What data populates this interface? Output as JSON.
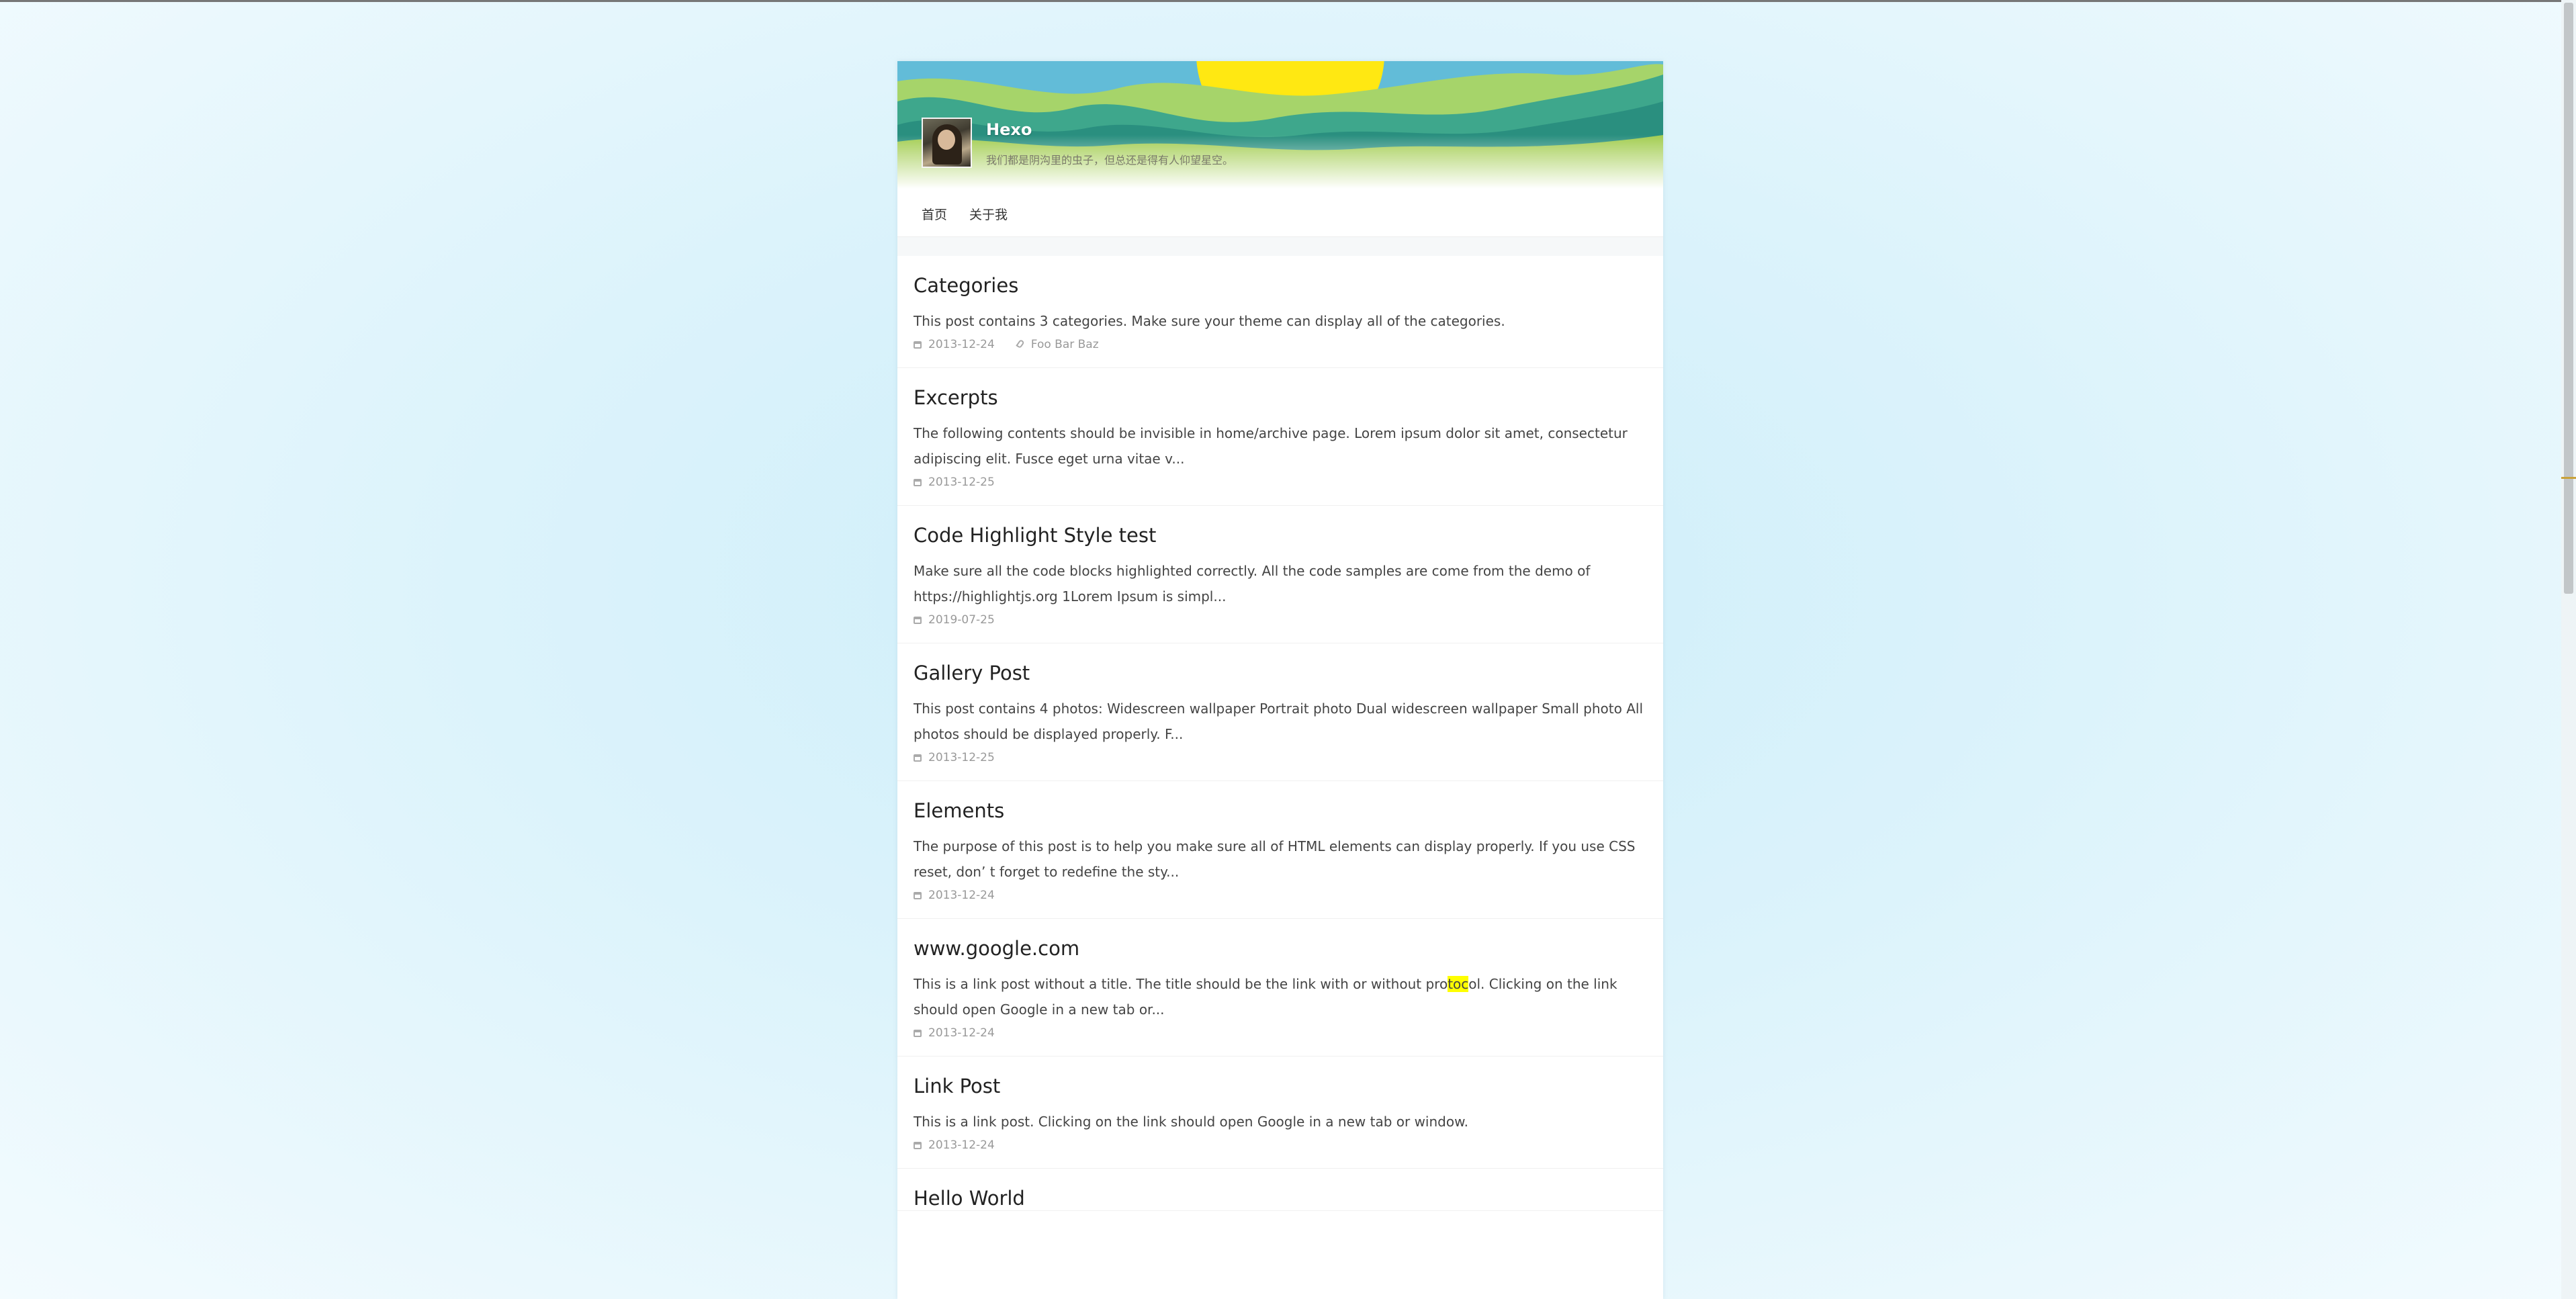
{
  "site": {
    "title": "Hexo",
    "subtitle": "我们都是阴沟里的虫子，但总还是得有人仰望星空。"
  },
  "nav": {
    "items": [
      {
        "label": "首页"
      },
      {
        "label": "关于我"
      }
    ]
  },
  "posts": [
    {
      "title": "Categories",
      "excerpt": "This post contains 3 categories. Make sure your theme can display all of the categories.",
      "date": "2013-12-24",
      "categories": "Foo Bar Baz"
    },
    {
      "title": "Excerpts",
      "excerpt": "The following contents should be invisible in home/archive page. Lorem ipsum dolor sit amet, consectetur adipiscing elit. Fusce eget urna vitae v...",
      "date": "2013-12-25"
    },
    {
      "title": "Code Highlight Style test",
      "excerpt": "Make sure all the code blocks highlighted correctly. All the code samples are come from the demo of https://highlightjs.org 1Lorem Ipsum is simpl...",
      "date": "2019-07-25"
    },
    {
      "title": "Gallery Post",
      "excerpt": "This post contains 4 photos: Widescreen wallpaper Portrait photo Dual widescreen wallpaper Small photo All photos should be displayed properly. F...",
      "date": "2013-12-25"
    },
    {
      "title": "Elements",
      "excerpt": "The purpose of this post is to help you make sure all of HTML elements can display properly. If you use CSS reset, don’ t forget to redefine the sty...",
      "date": "2013-12-24"
    },
    {
      "title": "www.google.com",
      "excerpt_before": "This is a link post without a title. The title should be the link with or without pro",
      "excerpt_highlight": "toc",
      "excerpt_after": "ol. Clicking on the link should open Google in a new tab or...",
      "date": "2013-12-24"
    },
    {
      "title": "Link Post",
      "excerpt": "This is a link post. Clicking on the link should open Google in a new tab or window.",
      "date": "2013-12-24"
    },
    {
      "title": "Hello World"
    }
  ],
  "colors": {
    "highlight": "#ffff00",
    "banner_sun": "#ffe812",
    "banner_hills_dark": "#1f8a7e",
    "banner_hills_light": "#b9d84a"
  }
}
